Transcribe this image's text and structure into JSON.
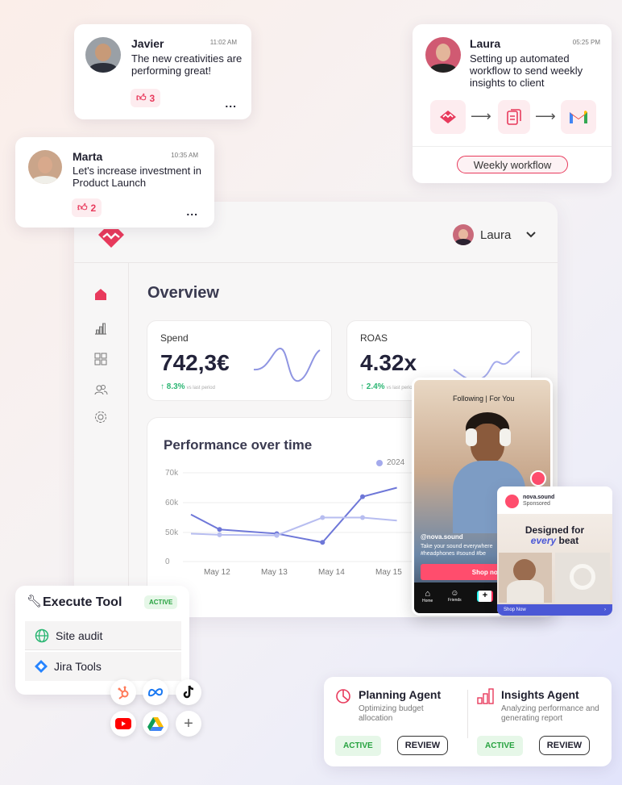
{
  "colors": {
    "brand": "#e83a5c",
    "accent_blue": "#6e77d8",
    "active_green": "#26a23f"
  },
  "notifications": {
    "javier": {
      "name": "Javier",
      "time": "11:02 AM",
      "message": "The new creativities are performing great!",
      "likes": "3",
      "more": "..."
    },
    "marta": {
      "name": "Marta",
      "time": "10:35 AM",
      "message": "Let's increase investment in Product Launch",
      "likes": "2",
      "more": "..."
    },
    "laura": {
      "name": "Laura",
      "time": "05:25 PM",
      "message": "Setting up automated workflow to send weekly insights to client",
      "workflow_button": "Weekly workflow",
      "icons": [
        "brand-logo-icon",
        "document-icon",
        "gmail-icon"
      ]
    }
  },
  "dashboard": {
    "user": "Laura",
    "title": "Overview",
    "sidebar": [
      "home-icon",
      "bar-chart-icon",
      "grid-icon",
      "users-icon",
      "settings-icon"
    ],
    "metrics": [
      {
        "label": "Spend",
        "value": "742,3€",
        "delta": "↑ 8.3%",
        "delta_note": "vs last period"
      },
      {
        "label": "ROAS",
        "value": "4.32x",
        "delta": "↑ 2.4%",
        "delta_note": "vs last period"
      }
    ]
  },
  "chart_data": {
    "type": "line",
    "title": "Performance over time",
    "categories": [
      "May 12",
      "May 13",
      "May 14",
      "May 15"
    ],
    "y_ticks": [
      "70k",
      "60k",
      "50k",
      "0"
    ],
    "legend": [
      "2024"
    ],
    "series": [
      {
        "name": "2024",
        "color": "#6e77d8",
        "values": [
          56,
          51,
          48,
          33,
          62,
          65
        ]
      },
      {
        "color": "#b7bdf0",
        "values": [
          48,
          46,
          45,
          55,
          55,
          54
        ]
      }
    ],
    "x_points": [
      0,
      0.5,
      1.5,
      2.3,
      3.0,
      3.6
    ]
  },
  "social_post": {
    "tabs": "Following | For You",
    "handle": "@nova.sound",
    "caption": "Take your sound everywhere #headphones #sound #be",
    "cta": "Shop now",
    "nav": [
      "Home",
      "Friends"
    ]
  },
  "ad": {
    "brand": "nova.sound",
    "sponsored": "Sponsored",
    "headline_1": "Designed for",
    "headline_em": "every",
    "headline_2": "beat",
    "cta": "Shop Now"
  },
  "execute_tool": {
    "title": "Execute Tool",
    "status": "ACTIVE",
    "items": [
      "Site audit",
      "Jira Tools"
    ],
    "integrations": [
      "hubspot-icon",
      "meta-icon",
      "tiktok-icon",
      "youtube-icon",
      "google-drive-icon",
      "add-icon"
    ]
  },
  "agents": [
    {
      "name": "Planning Agent",
      "desc": "Optimizing budget allocation",
      "status": "ACTIVE",
      "action": "REVIEW"
    },
    {
      "name": "Insights Agent",
      "desc": "Analyzing performance and generating report",
      "status": "ACTIVE",
      "action": "REVIEW"
    }
  ]
}
